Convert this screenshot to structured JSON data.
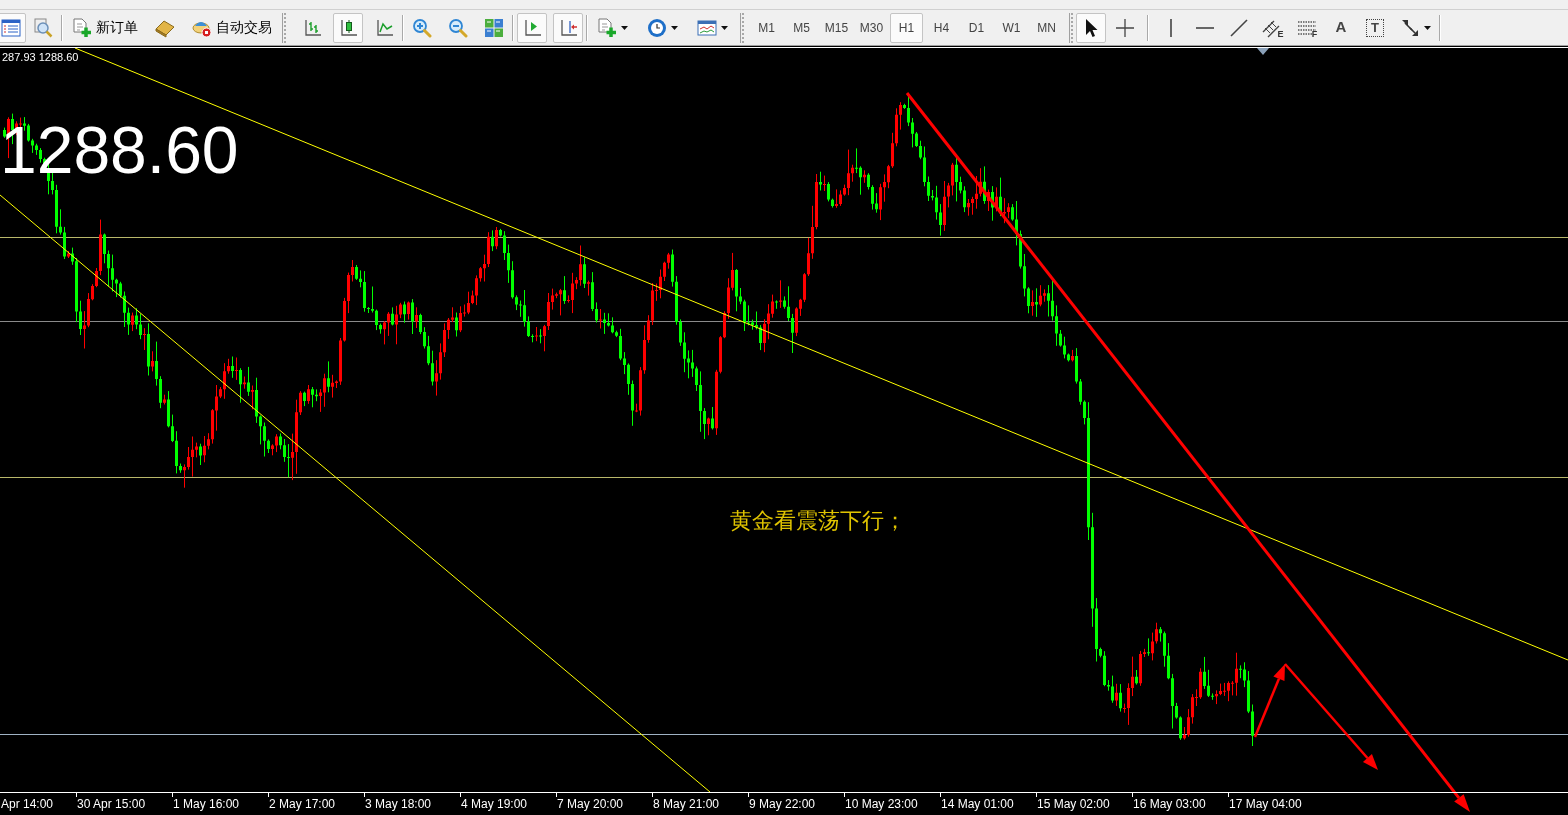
{
  "toolbar": {
    "groups": [
      {
        "items": [
          {
            "kind": "icon",
            "on": true
          },
          {
            "kind": "icon",
            "on": false
          }
        ]
      },
      {
        "items": [
          {
            "kind": "labeled",
            "label": "新订单"
          },
          {
            "kind": "icon"
          },
          {
            "kind": "labeled",
            "label": "自动交易"
          }
        ]
      },
      {
        "items": [
          {
            "kind": "icon",
            "selected": false
          },
          {
            "kind": "icon",
            "selected": true
          },
          {
            "kind": "icon",
            "selected": false
          }
        ]
      },
      {
        "items": [
          {
            "kind": "icon"
          },
          {
            "kind": "icon"
          },
          {
            "kind": "icon"
          }
        ]
      },
      {
        "items": [
          {
            "kind": "icon",
            "on": true
          },
          {
            "kind": "icon",
            "on": true
          }
        ]
      },
      {
        "items": [
          {
            "kind": "menu"
          },
          {
            "kind": "menu"
          },
          {
            "kind": "menu"
          }
        ]
      }
    ],
    "timeframes": [
      {
        "label": "M1",
        "selected": false
      },
      {
        "label": "M5",
        "selected": false
      },
      {
        "label": "M15",
        "selected": false
      },
      {
        "label": "M30",
        "selected": false
      },
      {
        "label": "H1",
        "selected": true
      },
      {
        "label": "H4",
        "selected": false
      },
      {
        "label": "D1",
        "selected": false
      },
      {
        "label": "W1",
        "selected": false
      },
      {
        "label": "MN",
        "selected": false
      }
    ],
    "tools": [
      {
        "kind": "icon",
        "selected": true
      },
      {
        "kind": "icon",
        "selected": false
      },
      {
        "kind": "icon",
        "selected": false
      },
      {
        "kind": "icon",
        "selected": false
      },
      {
        "kind": "icon",
        "selected": false
      },
      {
        "kind": "lettered",
        "letter": "E",
        "selected": false
      },
      {
        "kind": "lettered",
        "letter": "F",
        "selected": false
      },
      {
        "kind": "text",
        "label": "A",
        "selected": false
      },
      {
        "kind": "boxed",
        "label": "T",
        "selected": false
      },
      {
        "kind": "menu",
        "selected": false
      }
    ]
  },
  "chart": {
    "price_readout": "287.93 1288.60",
    "last_price": "1288.60",
    "annotation": "黄金看震荡下行；",
    "time_axis": [
      "Apr 14:00",
      "30 Apr 15:00",
      "1 May 16:00",
      "2 May 17:00",
      "3 May 18:00",
      "4 May 19:00",
      "7 May 20:00",
      "8 May 21:00",
      "9 May 22:00",
      "10 May 23:00",
      "14 May 01:00",
      "15 May 02:00",
      "16 May 03:00",
      "17 May 04:00"
    ]
  }
}
